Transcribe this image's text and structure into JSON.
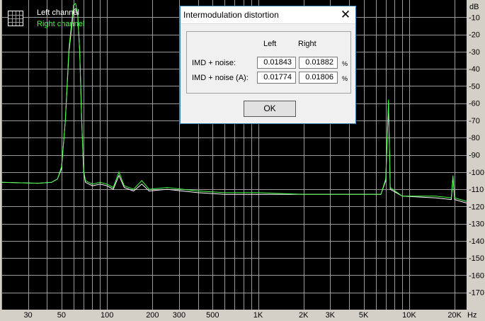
{
  "spectrum": {
    "y_unit": "dB",
    "x_unit": "Hz",
    "y_ticks": [
      -10,
      -20,
      -30,
      -40,
      -50,
      -60,
      -70,
      -80,
      -90,
      -100,
      -110,
      -120,
      -130,
      -140,
      -150,
      -160,
      -170
    ],
    "x_ticks": [
      {
        "value": 30,
        "label": "30"
      },
      {
        "value": 50,
        "label": "50"
      },
      {
        "value": 100,
        "label": "100"
      },
      {
        "value": 200,
        "label": "200"
      },
      {
        "value": 300,
        "label": "300"
      },
      {
        "value": 500,
        "label": "500"
      },
      {
        "value": 1000,
        "label": "1K"
      },
      {
        "value": 2000,
        "label": "2K"
      },
      {
        "value": 3000,
        "label": "3K"
      },
      {
        "value": 5000,
        "label": "5K"
      },
      {
        "value": 10000,
        "label": "10K"
      },
      {
        "value": 20000,
        "label": "20K"
      }
    ],
    "x_range": [
      20,
      24000
    ],
    "y_range": [
      0,
      -180
    ],
    "x_scale": "log",
    "legend": [
      "Left channel",
      "Right channel"
    ],
    "colors": {
      "background": "#000000",
      "grid": "#9a9a9a",
      "left": "#ffffff",
      "right": "#44ff44",
      "frame": "#d4d0c8"
    },
    "series": [
      {
        "name": "Left channel",
        "points": [
          [
            20,
            -106
          ],
          [
            35,
            -106.5
          ],
          [
            43,
            -106
          ],
          [
            47,
            -104
          ],
          [
            50,
            -98
          ],
          [
            53,
            -70
          ],
          [
            56,
            -30
          ],
          [
            60,
            -6
          ],
          [
            62,
            -5
          ],
          [
            64,
            -9
          ],
          [
            66,
            -30
          ],
          [
            68,
            -70
          ],
          [
            70,
            -100
          ],
          [
            72,
            -106
          ],
          [
            80,
            -108
          ],
          [
            90,
            -107
          ],
          [
            100,
            -108
          ],
          [
            110,
            -110
          ],
          [
            120,
            -102
          ],
          [
            130,
            -109
          ],
          [
            150,
            -111
          ],
          [
            170,
            -107
          ],
          [
            190,
            -111
          ],
          [
            250,
            -110
          ],
          [
            400,
            -112
          ],
          [
            600,
            -113
          ],
          [
            1000,
            -113
          ],
          [
            2000,
            -113
          ],
          [
            4000,
            -113
          ],
          [
            6500,
            -113
          ],
          [
            7000,
            -105
          ],
          [
            7300,
            -60
          ],
          [
            7500,
            -110
          ],
          [
            9000,
            -114
          ],
          [
            15000,
            -115
          ],
          [
            19000,
            -116
          ],
          [
            19500,
            -103
          ],
          [
            20000,
            -116
          ],
          [
            24000,
            -118
          ]
        ]
      },
      {
        "name": "Right channel",
        "points": [
          [
            20,
            -106
          ],
          [
            35,
            -106.5
          ],
          [
            43,
            -106
          ],
          [
            47,
            -104
          ],
          [
            50,
            -97
          ],
          [
            53,
            -70
          ],
          [
            56,
            -28
          ],
          [
            60,
            -3
          ],
          [
            62,
            -2
          ],
          [
            64,
            -8
          ],
          [
            66,
            -30
          ],
          [
            68,
            -70
          ],
          [
            70,
            -99
          ],
          [
            72,
            -105
          ],
          [
            80,
            -107
          ],
          [
            90,
            -106
          ],
          [
            100,
            -107
          ],
          [
            110,
            -109
          ],
          [
            120,
            -100
          ],
          [
            130,
            -108
          ],
          [
            150,
            -110
          ],
          [
            170,
            -105
          ],
          [
            190,
            -110
          ],
          [
            250,
            -109
          ],
          [
            400,
            -111
          ],
          [
            600,
            -112
          ],
          [
            1000,
            -112
          ],
          [
            2000,
            -113
          ],
          [
            4000,
            -113
          ],
          [
            6500,
            -113
          ],
          [
            7000,
            -104
          ],
          [
            7300,
            -58
          ],
          [
            7500,
            -109
          ],
          [
            9000,
            -114
          ],
          [
            15000,
            -114
          ],
          [
            19000,
            -115
          ],
          [
            19500,
            -102
          ],
          [
            20000,
            -115
          ],
          [
            24000,
            -117
          ]
        ]
      }
    ]
  },
  "dialog": {
    "title": "Intermodulation distortion",
    "close_glyph": "✕",
    "col_left": "Left",
    "col_right": "Right",
    "rows": [
      {
        "label": "IMD + noise:",
        "left": "0.01843",
        "right": "0.01882",
        "unit": "%"
      },
      {
        "label": "IMD + noise (A):",
        "left": "0.01774",
        "right": "0.01806",
        "unit": "%"
      }
    ],
    "ok_label": "OK"
  }
}
